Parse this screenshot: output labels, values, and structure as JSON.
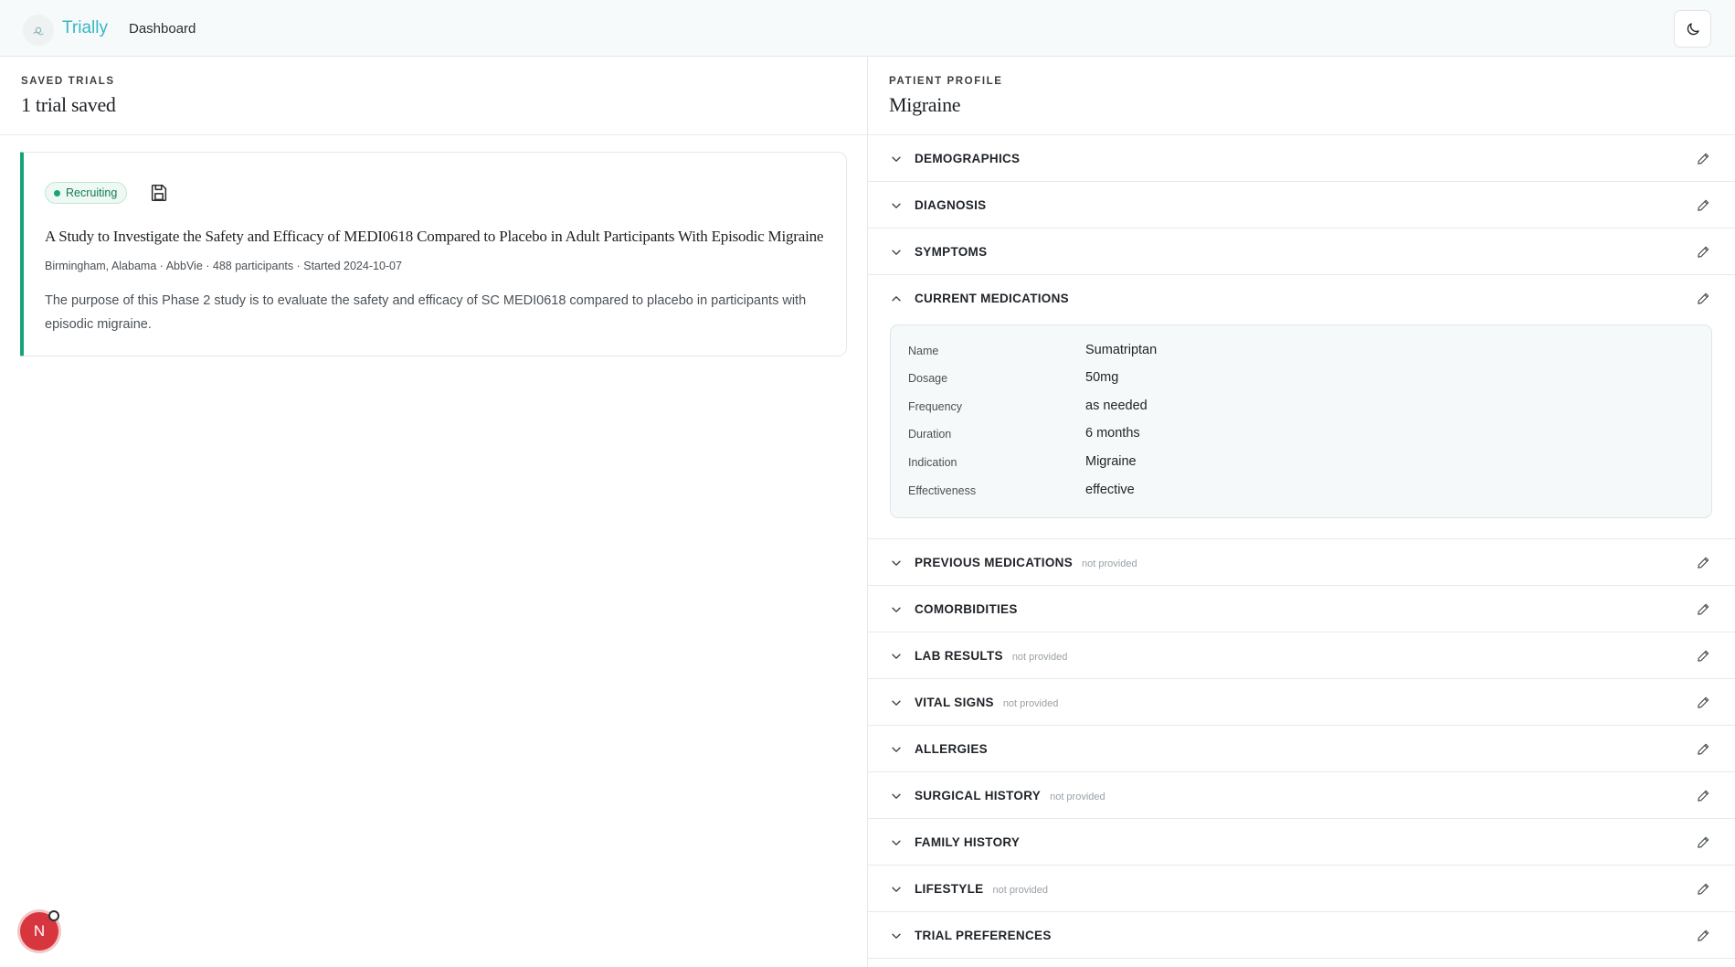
{
  "header": {
    "brand": "Trially",
    "nav_link": "Dashboard",
    "theme_toggle_icon": "moon-icon"
  },
  "saved_trials": {
    "kicker": "SAVED TRIALS",
    "count_label": "1 trial saved",
    "trials": [
      {
        "status": "Recruiting",
        "title": "A Study to Investigate the Safety and Efficacy of MEDI0618 Compared to Placebo in Adult Participants With Episodic Migraine",
        "meta": "Birmingham, Alabama · AbbVie · 488 participants · Started 2024-10-07",
        "description": "The purpose of this Phase 2 study is to evaluate the safety and efficacy of SC MEDI0618 compared to placebo in participants with episodic migraine."
      }
    ]
  },
  "patient_profile": {
    "kicker": "PATIENT PROFILE",
    "condition": "Migraine",
    "sections": [
      {
        "label": "DEMOGRAPHICS",
        "note": ""
      },
      {
        "label": "DIAGNOSIS",
        "note": ""
      },
      {
        "label": "SYMPTOMS",
        "note": ""
      },
      {
        "label": "CURRENT MEDICATIONS",
        "note": "",
        "expanded": true
      },
      {
        "label": "PREVIOUS MEDICATIONS",
        "note": "not provided"
      },
      {
        "label": "COMORBIDITIES",
        "note": ""
      },
      {
        "label": "LAB RESULTS",
        "note": "not provided"
      },
      {
        "label": "VITAL SIGNS",
        "note": "not provided"
      },
      {
        "label": "ALLERGIES",
        "note": ""
      },
      {
        "label": "SURGICAL HISTORY",
        "note": "not provided"
      },
      {
        "label": "FAMILY HISTORY",
        "note": ""
      },
      {
        "label": "LIFESTYLE",
        "note": "not provided"
      },
      {
        "label": "TRIAL PREFERENCES",
        "note": ""
      }
    ],
    "current_medication": {
      "fields": [
        {
          "key": "Name",
          "value": "Sumatriptan"
        },
        {
          "key": "Dosage",
          "value": "50mg"
        },
        {
          "key": "Frequency",
          "value": "as needed"
        },
        {
          "key": "Duration",
          "value": "6 months"
        },
        {
          "key": "Indication",
          "value": "Migraine"
        },
        {
          "key": "Effectiveness",
          "value": "effective"
        }
      ]
    }
  },
  "floating_avatar": {
    "initial": "N"
  },
  "colors": {
    "brand": "#38b6c6",
    "status_green": "#16a37a",
    "avatar_red": "#d8363e"
  }
}
